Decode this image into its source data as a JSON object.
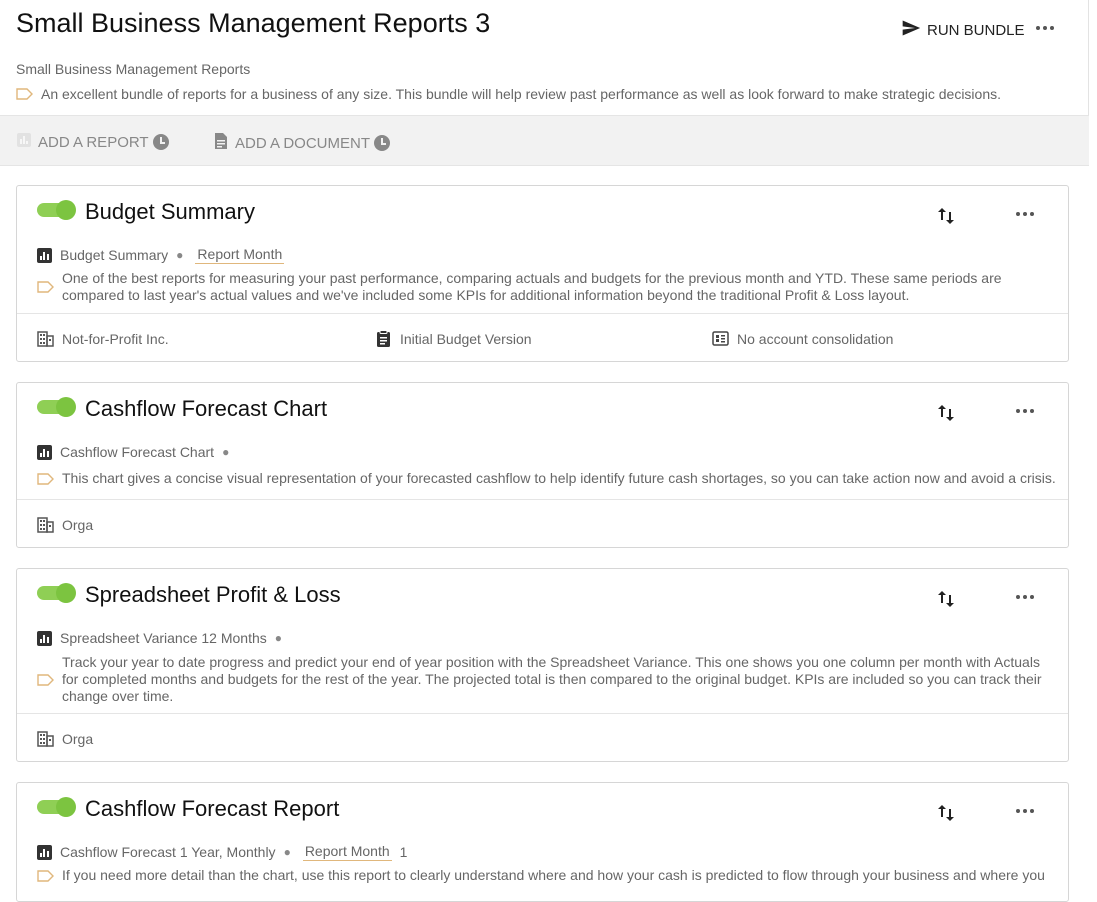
{
  "header": {
    "title": "Small Business Management Reports 3",
    "run_bundle_label": "RUN BUNDLE",
    "subtitle": "Small Business Management Reports",
    "description": "An excellent bundle of reports for a business of any size. This bundle will help review past performance as well as look forward to make strategic decisions."
  },
  "add_bar": {
    "add_report_label": "ADD A REPORT",
    "add_document_label": "ADD A DOCUMENT"
  },
  "cards": [
    {
      "title": "Budget Summary",
      "report_name": "Budget Summary",
      "param": "Report Month",
      "description_lines": [
        "One of the best reports for measuring your past performance, comparing actuals and budgets for the previous month and YTD. These same periods are",
        "compared to last year's actual values and we've included some KPIs for additional information beyond the traditional Profit & Loss layout."
      ],
      "footer": {
        "organization": "Not-for-Profit Inc.",
        "budget_version": "Initial Budget Version",
        "consolidation": "No account consolidation"
      }
    },
    {
      "title": "Cashflow Forecast Chart",
      "report_name": "Cashflow Forecast Chart",
      "description_lines": [
        "This chart gives a concise visual representation of your forecasted cashflow to help identify future cash shortages, so you can take action now and avoid a crisis."
      ],
      "footer": {
        "organization": "Orga"
      }
    },
    {
      "title": "Spreadsheet Profit & Loss",
      "report_name": "Spreadsheet Variance 12 Months",
      "description_lines": [
        "Track your year to date progress and predict your end of year position with the Spreadsheet Variance. This one shows you one column per month with Actuals",
        "for completed months and budgets for the rest of the year. The projected total is then compared to the original budget. KPIs are included so you can track their",
        "change over time."
      ],
      "footer": {
        "organization": "Orga"
      }
    },
    {
      "title": "Cashflow Forecast Report",
      "report_name": "Cashflow Forecast 1 Year, Monthly",
      "param": "Report Month",
      "param_value": "1",
      "description_lines": [
        "If you need more detail than the chart, use this report to clearly understand where and how your cash is predicted to flow through your business and where you"
      ]
    }
  ],
  "colors": {
    "toggle_on": "#7cc440",
    "param_underline": "#e0b77c",
    "tag_outline": "#e0b77c"
  }
}
